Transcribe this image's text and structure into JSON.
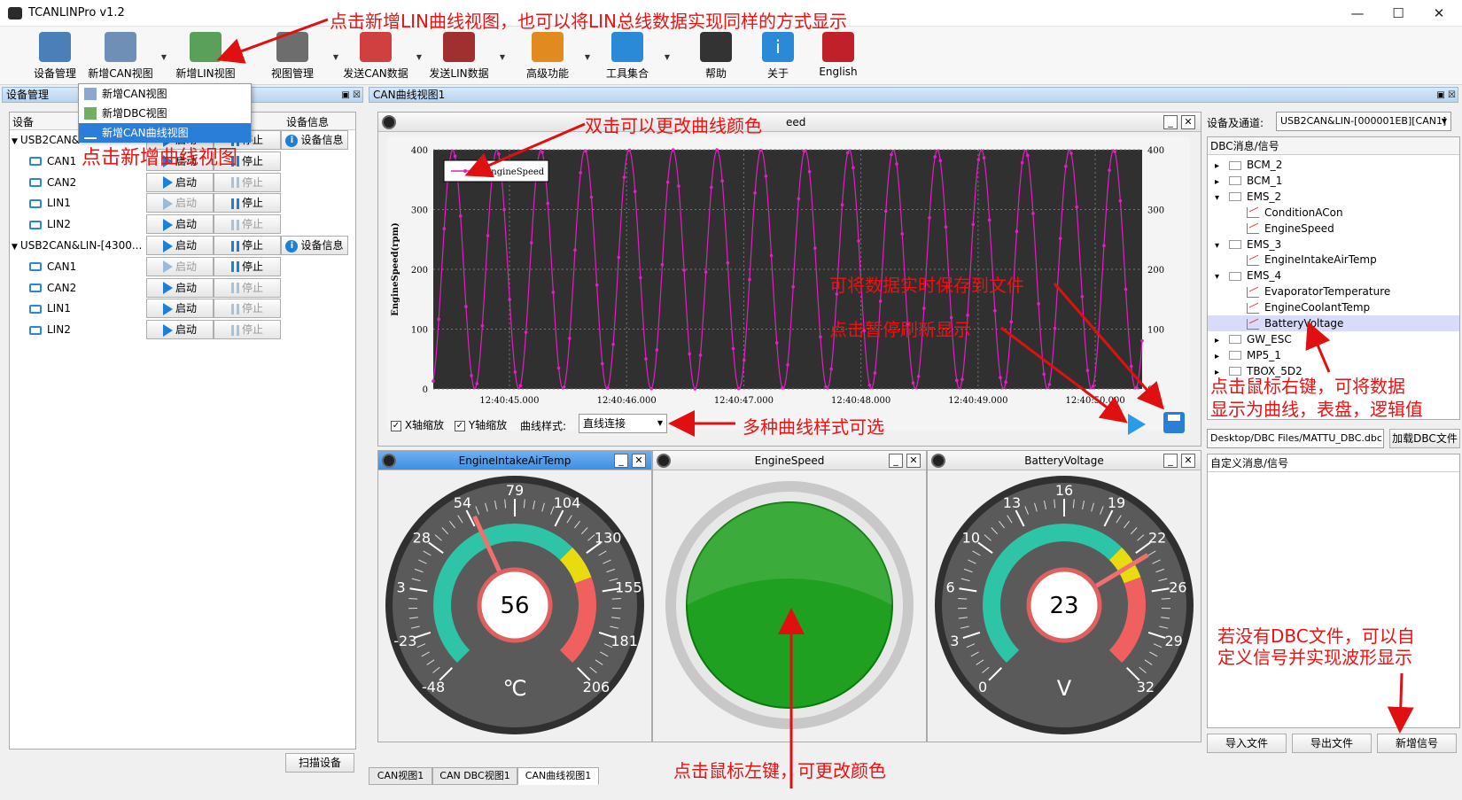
{
  "app": {
    "title": "TCANLINPro v1.2"
  },
  "window": {
    "min": "—",
    "max": "☐",
    "close": "✕"
  },
  "toolbar": [
    {
      "label": "设备管理",
      "icon": "device-icon",
      "color": "#4a7fb8"
    },
    {
      "label": "新增CAN视图",
      "icon": "add-can-view-icon",
      "color": "#6f8fb7"
    },
    {
      "label": "新增LIN视图",
      "icon": "add-lin-view-icon",
      "color": "#5aa05a"
    },
    {
      "label": "视图管理",
      "icon": "view-manage-icon",
      "color": "#6d6d6d"
    },
    {
      "label": "发送CAN数据",
      "icon": "send-can-icon",
      "color": "#d04040"
    },
    {
      "label": "发送LIN数据",
      "icon": "send-lin-icon",
      "color": "#a03030"
    },
    {
      "label": "高级功能",
      "icon": "advanced-icon",
      "color": "#e08a20"
    },
    {
      "label": "工具集合",
      "icon": "tools-icon",
      "color": "#2a8ad8"
    },
    {
      "label": "帮助",
      "icon": "help-icon",
      "color": "#333333"
    },
    {
      "label": "关于",
      "icon": "about-icon",
      "color": "#2a8ad8"
    },
    {
      "label": "English",
      "icon": "english-flag-icon",
      "color": "#c0202a"
    }
  ],
  "dropdown": [
    "新增CAN视图",
    "新增DBC视图",
    "新增CAN曲线视图"
  ],
  "left": {
    "title": "设备管理",
    "headers": [
      "设备",
      "设备信息"
    ],
    "start": "启动",
    "stop": "停止",
    "info": "设备信息",
    "scan": "扫描设备",
    "rows": [
      {
        "name": "USB2CAN&",
        "level": 0,
        "start": true,
        "stop": true,
        "info": true
      },
      {
        "name": "CAN1",
        "level": 1,
        "start": true,
        "stop": true
      },
      {
        "name": "CAN2",
        "level": 1,
        "start": true,
        "stop": false
      },
      {
        "name": "LIN1",
        "level": 1,
        "start": false,
        "stop": true
      },
      {
        "name": "LIN2",
        "level": 1,
        "start": true,
        "stop": false
      },
      {
        "name": "USB2CAN&LIN-[4300...",
        "level": 0,
        "start": true,
        "stop": true,
        "info": true
      },
      {
        "name": "CAN1",
        "level": 1,
        "start": false,
        "stop": true
      },
      {
        "name": "CAN2",
        "level": 1,
        "start": true,
        "stop": false
      },
      {
        "name": "LIN1",
        "level": 1,
        "start": true,
        "stop": false
      },
      {
        "name": "LIN2",
        "level": 1,
        "start": true,
        "stop": false
      }
    ]
  },
  "center": {
    "title": "CAN曲线视图1",
    "plot": {
      "title": "eed",
      "xscale": "X轴缩放",
      "yscale": "Y轴缩放",
      "style_label": "曲线样式:",
      "style_value": "直线连接",
      "legend": "EngineSpeed",
      "ylabel": "EngineSpeed(rpm)"
    },
    "gauges": [
      {
        "title": "EngineIntakeAirTemp",
        "value": "56",
        "unit": "℃",
        "ticks": [
          "-48",
          "-23",
          "3",
          "28",
          "54",
          "79",
          "104",
          "130",
          "155",
          "181",
          "206"
        ],
        "val": 56,
        "min": -48,
        "max": 206,
        "active": true
      },
      {
        "title": "EngineSpeed"
      },
      {
        "title": "BatteryVoltage",
        "value": "23",
        "unit": "V",
        "ticks": [
          "0",
          "3",
          "6",
          "10",
          "13",
          "16",
          "19",
          "22",
          "26",
          "29",
          "32"
        ],
        "val": 23,
        "min": 0,
        "max": 32
      }
    ]
  },
  "tabs": [
    "CAN视图1",
    "CAN DBC视图1",
    "CAN曲线视图1"
  ],
  "right": {
    "device_label": "设备及通道:",
    "device_value": "USB2CAN&LIN-[000001EB][CAN1]",
    "dbc_title": "DBC消息/信号",
    "tree": [
      {
        "t": "BCM_2",
        "lvl": 0,
        "exp": "▸"
      },
      {
        "t": "BCM_1",
        "lvl": 0,
        "exp": "▸"
      },
      {
        "t": "EMS_2",
        "lvl": 0,
        "exp": "▾"
      },
      {
        "t": "ConditionACon",
        "lvl": 1
      },
      {
        "t": "EngineSpeed",
        "lvl": 1
      },
      {
        "t": "EMS_3",
        "lvl": 0,
        "exp": "▾"
      },
      {
        "t": "EngineIntakeAirTemp",
        "lvl": 1
      },
      {
        "t": "EMS_4",
        "lvl": 0,
        "exp": "▾"
      },
      {
        "t": "EvaporatorTemperature",
        "lvl": 1
      },
      {
        "t": "EngineCoolantTemp",
        "lvl": 1
      },
      {
        "t": "BatteryVoltage",
        "lvl": 1,
        "sel": true
      },
      {
        "t": "GW_ESC",
        "lvl": 0,
        "exp": "▸"
      },
      {
        "t": "MP5_1",
        "lvl": 0,
        "exp": "▸"
      },
      {
        "t": "TBOX_5D2",
        "lvl": 0,
        "exp": "▸"
      }
    ],
    "dbc_path": "Desktop/DBC Files/MATTU_DBC.dbc",
    "load_dbc": "加载DBC文件",
    "custom_title": "自定义消息/信号",
    "import": "导入文件",
    "export": "导出文件",
    "add_signal": "新增信号"
  },
  "annotations": {
    "a1": "点击新增LIN曲线视图，也可以将LIN总线数据实现同样的方式显示",
    "a2": "点击新增曲线视图",
    "a3": "双击可以更改曲线颜色",
    "a4": "可将数据实时保存到文件",
    "a5": "点击暂停刷新显示",
    "a6": "多种曲线样式可选",
    "a7a": "点击鼠标右键，可将数据",
    "a7b": "显示为曲线，表盘，逻辑值",
    "a8a": "若没有DBC文件，可以自",
    "a8b": "定义信号并实现波形显示",
    "a9": "点击鼠标左键，可更改颜色"
  },
  "chart_data": {
    "type": "line",
    "title": "",
    "xlabel": "",
    "ylabel": "EngineSpeed(rpm)",
    "ylim": [
      0,
      400
    ],
    "xticks": [
      "12:40:45.000",
      "12:40:46.000",
      "12:40:47.000",
      "12:40:48.000",
      "12:40:49.000",
      "12:40:50.000"
    ],
    "yticks": [
      0,
      100,
      200,
      300,
      400
    ],
    "series": [
      {
        "name": "EngineSpeed",
        "color": "#e020c0",
        "description": "sinusoid 0-400 rpm, ~16 cycles across window"
      }
    ],
    "x_start": 44.35,
    "x_end": 50.4,
    "period_s": 0.376,
    "grid": true,
    "legend": "top-left"
  }
}
